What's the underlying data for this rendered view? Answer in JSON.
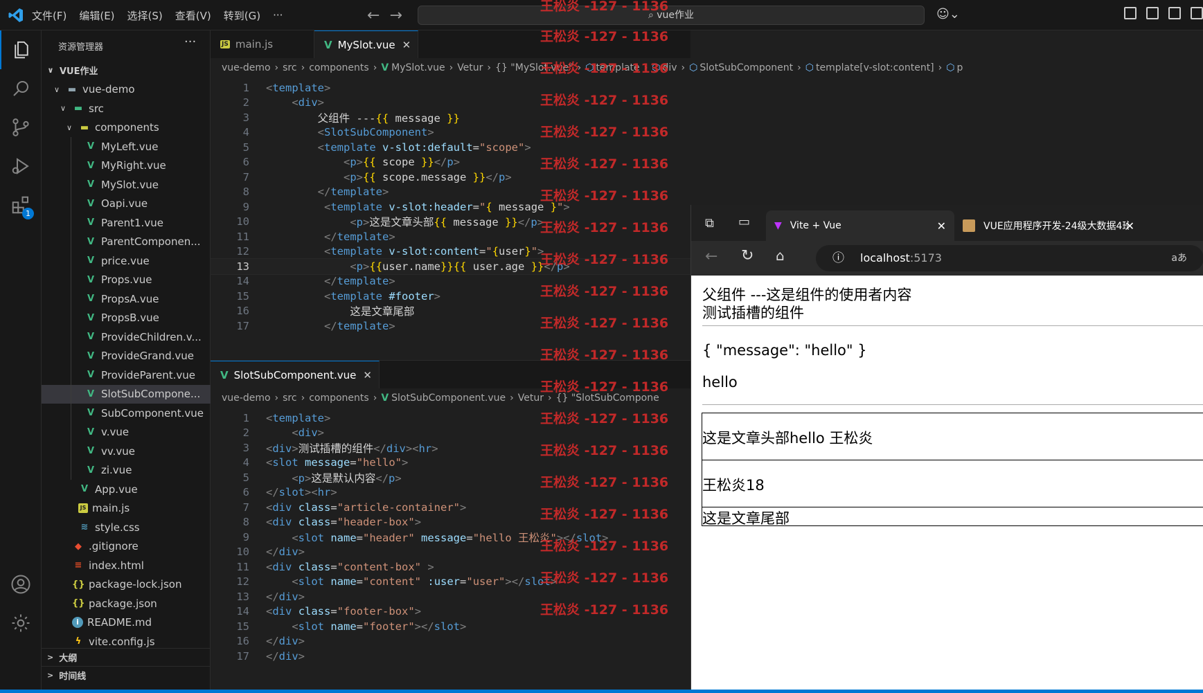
{
  "menu": [
    "文件(F)",
    "编辑(E)",
    "选择(S)",
    "查看(V)",
    "转到(G)",
    "···"
  ],
  "search_text": "vue作业",
  "activity_badge": "1",
  "explorer": {
    "title": "资源管理器",
    "more": "···",
    "root": "VUE作业",
    "items": [
      {
        "label": "vue-demo",
        "icon": "folder-icon",
        "indent": 1,
        "chev": "∨"
      },
      {
        "label": "src",
        "icon": "folder-src-icon",
        "indent": 2,
        "chev": "∨"
      },
      {
        "label": "components",
        "icon": "folder-components-icon",
        "indent": 3,
        "chev": "∨"
      },
      {
        "label": "MyLeft.vue",
        "icon": "vue-icon",
        "indent": 4
      },
      {
        "label": "MyRight.vue",
        "icon": "vue-icon",
        "indent": 4
      },
      {
        "label": "MySlot.vue",
        "icon": "vue-icon",
        "indent": 4
      },
      {
        "label": "Oapi.vue",
        "icon": "vue-icon",
        "indent": 4
      },
      {
        "label": "Parent1.vue",
        "icon": "vue-icon",
        "indent": 4
      },
      {
        "label": "ParentComponen...",
        "icon": "vue-icon",
        "indent": 4
      },
      {
        "label": "price.vue",
        "icon": "vue-icon",
        "indent": 4
      },
      {
        "label": "Props.vue",
        "icon": "vue-icon",
        "indent": 4
      },
      {
        "label": "PropsA.vue",
        "icon": "vue-icon",
        "indent": 4
      },
      {
        "label": "PropsB.vue",
        "icon": "vue-icon",
        "indent": 4
      },
      {
        "label": "ProvideChildren.v...",
        "icon": "vue-icon",
        "indent": 4
      },
      {
        "label": "ProvideGrand.vue",
        "icon": "vue-icon",
        "indent": 4
      },
      {
        "label": "ProvideParent.vue",
        "icon": "vue-icon",
        "indent": 4
      },
      {
        "label": "SlotSubCompone...",
        "icon": "vue-icon",
        "indent": 4,
        "selected": true
      },
      {
        "label": "SubComponent.vue",
        "icon": "vue-icon",
        "indent": 4
      },
      {
        "label": "v.vue",
        "icon": "vue-icon",
        "indent": 4
      },
      {
        "label": "vv.vue",
        "icon": "vue-icon",
        "indent": 4
      },
      {
        "label": "zi.vue",
        "icon": "vue-icon",
        "indent": 4
      },
      {
        "label": "App.vue",
        "icon": "vue-icon",
        "indent": 3
      },
      {
        "label": "main.js",
        "icon": "js-icon",
        "indent": 3
      },
      {
        "label": "style.css",
        "icon": "css-icon",
        "indent": 3
      },
      {
        "label": ".gitignore",
        "icon": "git-icon",
        "indent": 2
      },
      {
        "label": "index.html",
        "icon": "html-icon",
        "indent": 2
      },
      {
        "label": "package-lock.json",
        "icon": "json-icon",
        "indent": 2
      },
      {
        "label": "package.json",
        "icon": "json-icon",
        "indent": 2
      },
      {
        "label": "README.md",
        "icon": "info-icon",
        "indent": 2
      },
      {
        "label": "vite.config.js",
        "icon": "vite-icon",
        "indent": 2
      }
    ],
    "sections": [
      "大纲",
      "时间线"
    ]
  },
  "editor_top": {
    "tabs": [
      {
        "label": "main.js",
        "icon": "JS",
        "active": false
      },
      {
        "label": "MySlot.vue",
        "icon": "V",
        "active": true,
        "close": "✕"
      }
    ],
    "crumbs": [
      "vue-demo",
      "src",
      "components",
      "MySlot.vue",
      "Vetur",
      "{} \"MySlot.vue\"",
      "template",
      "div",
      "SlotSubComponent",
      "template[v-slot:content]",
      "p"
    ],
    "current_line": 13
  },
  "editor_bottom": {
    "tab": "SlotSubComponent.vue",
    "close": "✕",
    "crumbs": [
      "vue-demo",
      "src",
      "components",
      "SlotSubComponent.vue",
      "Vetur",
      "{} \"SlotSubCompone"
    ]
  },
  "watermark": "王松炎 -127 - 1136",
  "browser": {
    "tabs": [
      {
        "label": "Vite + Vue",
        "close": "✕"
      },
      {
        "label": "VUE应用程序开发-24级大数据4班",
        "close": "✕"
      }
    ],
    "url_host": "localhost",
    "url_port": ":5173",
    "translate": "aあ",
    "content": {
      "line1": "父组件 ---这是组件的使用者内容",
      "line2": "测试插槽的组件",
      "json": "{ \"message\": \"hello\" }",
      "hello": "hello",
      "header": "这是文章头部hello 王松炎",
      "content": "王松炎18",
      "footer": "这是文章尾部"
    }
  }
}
